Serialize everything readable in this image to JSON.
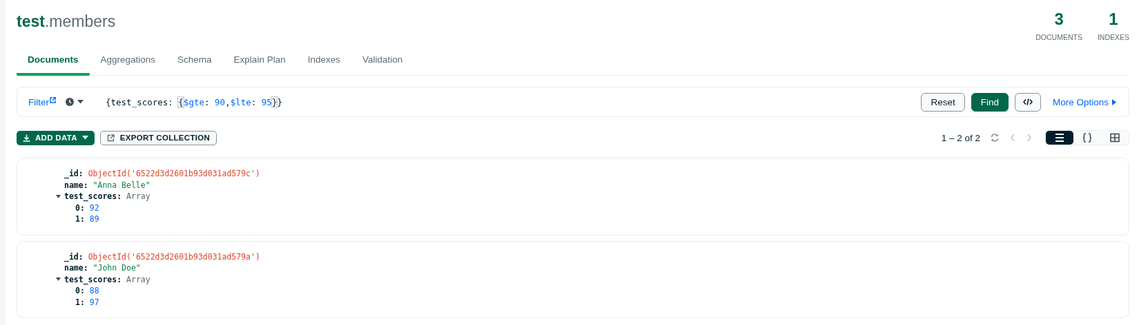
{
  "header": {
    "database": "test",
    "separator": ".",
    "collection": "members",
    "stats": [
      {
        "value": "3",
        "label": "DOCUMENTS"
      },
      {
        "value": "1",
        "label": "INDEXES"
      }
    ]
  },
  "tabs": [
    {
      "label": "Documents",
      "selected": true
    },
    {
      "label": "Aggregations",
      "selected": false
    },
    {
      "label": "Schema",
      "selected": false
    },
    {
      "label": "Explain Plan",
      "selected": false
    },
    {
      "label": "Indexes",
      "selected": false
    },
    {
      "label": "Validation",
      "selected": false
    }
  ],
  "query_bar": {
    "filter_label": "Filter",
    "query": [
      {
        "kind": "plain",
        "text": "{test_scores: "
      },
      {
        "kind": "brace",
        "text": "{"
      },
      {
        "kind": "operator",
        "text": "$gte"
      },
      {
        "kind": "plain",
        "text": ": "
      },
      {
        "kind": "number",
        "text": "90"
      },
      {
        "kind": "plain",
        "text": ","
      },
      {
        "kind": "operator",
        "text": "$lte"
      },
      {
        "kind": "plain",
        "text": ": "
      },
      {
        "kind": "number",
        "text": "95"
      },
      {
        "kind": "brace",
        "text": "}"
      },
      {
        "kind": "plain",
        "text": "}"
      }
    ],
    "buttons": [
      "Reset",
      "Find"
    ],
    "more_options": "More Options"
  },
  "toolbar": {
    "add_data": "ADD DATA",
    "export": "EXPORT COLLECTION",
    "pagination": "1 – 2 of 2",
    "views": [
      {
        "kind": "list",
        "selected": true
      },
      {
        "kind": "json",
        "selected": false
      },
      {
        "kind": "table",
        "selected": false
      }
    ]
  },
  "documents": [
    {
      "fields": [
        {
          "key": "_id:",
          "kind": "objectid",
          "value": "ObjectId('6522d3d2601b93d031ad579c')"
        },
        {
          "key": "name:",
          "kind": "string",
          "value": "\"Anna Belle\""
        },
        {
          "key": "test_scores:",
          "kind": "array",
          "value": "Array",
          "expanded": true,
          "children": [
            {
              "key": "0:",
              "kind": "number",
              "value": "92"
            },
            {
              "key": "1:",
              "kind": "number",
              "value": "89"
            }
          ]
        }
      ]
    },
    {
      "fields": [
        {
          "key": "_id:",
          "kind": "objectid",
          "value": "ObjectId('6522d3d2601b93d031ad579a')"
        },
        {
          "key": "name:",
          "kind": "string",
          "value": "\"John Doe\""
        },
        {
          "key": "test_scores:",
          "kind": "array",
          "value": "Array",
          "expanded": true,
          "children": [
            {
              "key": "0:",
              "kind": "number",
              "value": "88"
            },
            {
              "key": "1:",
              "kind": "number",
              "value": "97"
            }
          ]
        }
      ]
    }
  ]
}
